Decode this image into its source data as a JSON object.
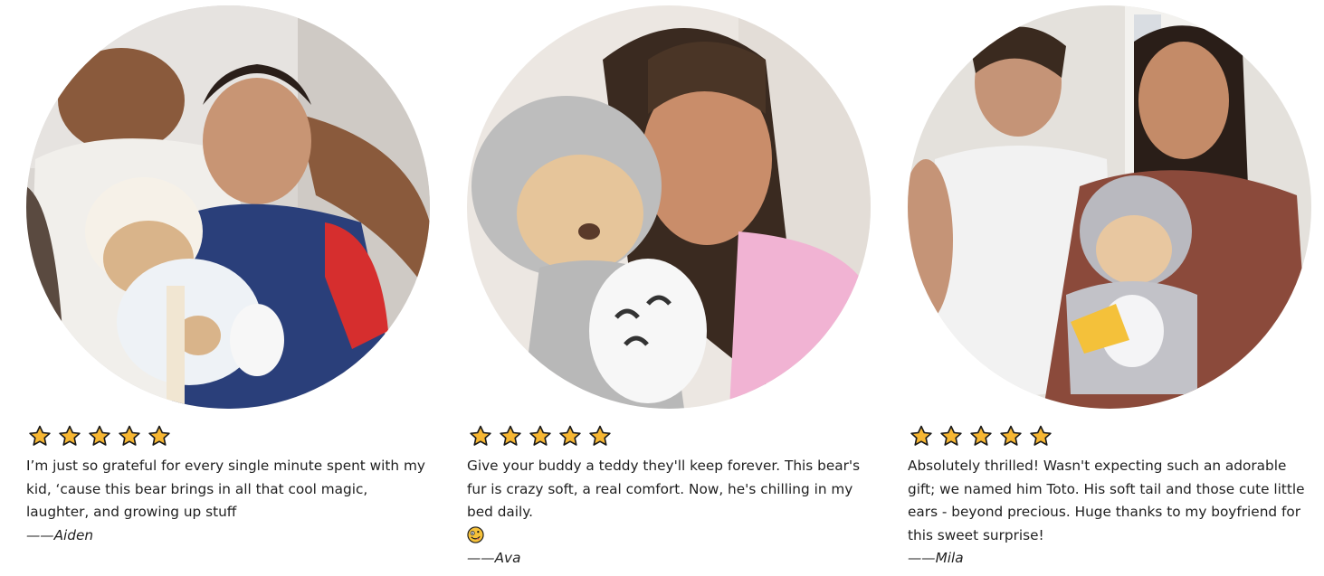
{
  "colors": {
    "star_fill": "#f7b733",
    "star_stroke": "#1a1a1a",
    "text": "#1f1f1f"
  },
  "reviews": [
    {
      "photo_icon": "father-son-teddy-bear-photo",
      "rating": 5,
      "text": "I’m just so grateful for every single minute spent with my kid, ‘cause this bear brings in all that cool magic, laughter, and growing up stuff",
      "emoji": "",
      "author": "——Aiden"
    },
    {
      "photo_icon": "woman-hugging-gray-teddy-photo",
      "rating": 5,
      "text": "Give your buddy a teddy they'll keep forever. This bear's fur is crazy soft, a real comfort. Now, he's chilling in my bed daily.",
      "emoji": "🤪",
      "author": "——Ava"
    },
    {
      "photo_icon": "couple-with-teddy-photo",
      "rating": 5,
      "text": "Absolutely thrilled! Wasn't expecting such an adorable gift; we named him Toto. His soft tail and those cute little ears - beyond precious. Huge thanks to my boyfriend for this sweet surprise!",
      "emoji": "",
      "author": "——Mila"
    }
  ]
}
